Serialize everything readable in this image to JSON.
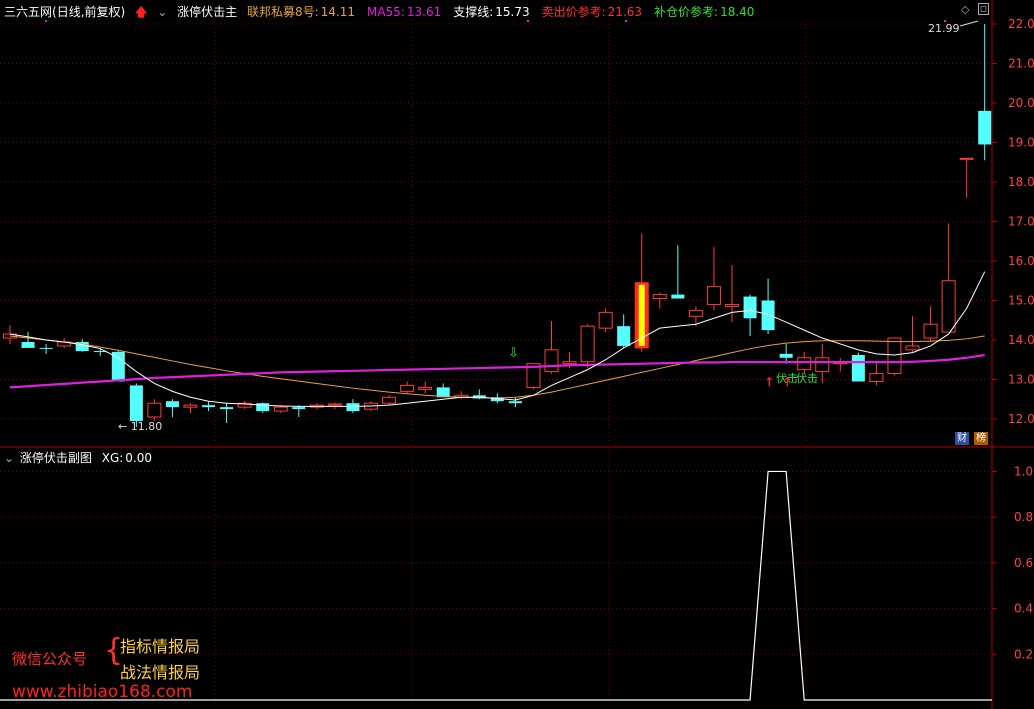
{
  "main_header": {
    "stock_name": "三六五网",
    "mode": "(日线,前复权)",
    "indicator": "涨停伏击主",
    "items": [
      {
        "label": "联邦私募8号:",
        "value": "14.11",
        "color": "#e8a33a"
      },
      {
        "label": "MA55:",
        "value": "13.61",
        "color": "#e020e0"
      },
      {
        "label": "支撑线:",
        "value": "15.73",
        "color": "#ffffff"
      },
      {
        "label": "卖出价参考:",
        "value": "21.63",
        "color": "#ff3030"
      },
      {
        "label": "补仓价参考:",
        "value": "18.40",
        "color": "#30e030"
      }
    ]
  },
  "sub_header": {
    "indicator": "涨停伏击副图",
    "label": "XG:",
    "value": "0.00"
  },
  "axis_main": {
    "ticks": [
      "22.00",
      "21.00",
      "20.00",
      "19.00",
      "18.00",
      "17.00",
      "16.00",
      "15.00",
      "14.00",
      "13.00",
      "12.00"
    ]
  },
  "axis_sub": {
    "ticks": [
      "1.00",
      "0.80",
      "0.60",
      "0.40",
      "0.20"
    ]
  },
  "annotations": {
    "high_label": "21.99",
    "low_label": "← 11.80",
    "signal_1": "伏击",
    "signal_2": "伏击",
    "signal_arrow": "⇩"
  },
  "corner_tags": {
    "tag1": "财",
    "tag2": "榜"
  },
  "watermark": {
    "line1": "微信公众号",
    "line2a": "指标情报局",
    "line2b": "战法情报局",
    "url": "www.zhibiao168.com"
  },
  "colors": {
    "up": "#ff3c3c",
    "down": "#54ffff",
    "ma_orange": "#e8a33a",
    "ma_magenta": "#e020e0",
    "support": "#ffffff",
    "grid": "#7a0000",
    "signal": "#ffff00"
  },
  "chart_data": {
    "type": "candlestick",
    "candles": [
      [
        14.05,
        14.38,
        13.9,
        14.15
      ],
      [
        13.95,
        14.2,
        13.85,
        13.8
      ],
      [
        13.8,
        13.9,
        13.65,
        13.78
      ],
      [
        13.85,
        14.05,
        13.8,
        13.95
      ],
      [
        13.95,
        14.02,
        13.7,
        13.72
      ],
      [
        13.72,
        13.78,
        13.6,
        13.7
      ],
      [
        13.7,
        13.72,
        12.95,
        12.95
      ],
      [
        12.85,
        12.9,
        11.8,
        11.95
      ],
      [
        12.05,
        12.5,
        11.95,
        12.4
      ],
      [
        12.45,
        12.5,
        12.05,
        12.3
      ],
      [
        12.3,
        12.4,
        12.15,
        12.35
      ],
      [
        12.35,
        12.45,
        12.2,
        12.3
      ],
      [
        12.3,
        12.4,
        11.9,
        12.25
      ],
      [
        12.3,
        12.45,
        12.25,
        12.4
      ],
      [
        12.4,
        12.42,
        12.15,
        12.2
      ],
      [
        12.2,
        12.35,
        12.15,
        12.3
      ],
      [
        12.3,
        12.35,
        12.05,
        12.25
      ],
      [
        12.3,
        12.4,
        12.25,
        12.35
      ],
      [
        12.35,
        12.42,
        12.25,
        12.38
      ],
      [
        12.4,
        12.5,
        12.15,
        12.2
      ],
      [
        12.25,
        12.45,
        12.2,
        12.4
      ],
      [
        12.4,
        12.6,
        12.35,
        12.55
      ],
      [
        12.7,
        12.95,
        12.65,
        12.85
      ],
      [
        12.75,
        12.95,
        12.65,
        12.8
      ],
      [
        12.8,
        12.9,
        12.55,
        12.55
      ],
      [
        12.55,
        12.7,
        12.5,
        12.6
      ],
      [
        12.6,
        12.75,
        12.5,
        12.52
      ],
      [
        12.55,
        12.65,
        12.4,
        12.45
      ],
      [
        12.45,
        12.55,
        12.3,
        12.4
      ],
      [
        12.8,
        13.4,
        12.75,
        13.4
      ],
      [
        13.2,
        14.48,
        13.15,
        13.75
      ],
      [
        13.4,
        13.7,
        13.3,
        13.45
      ],
      [
        13.45,
        14.4,
        13.3,
        14.35
      ],
      [
        14.3,
        14.8,
        14.2,
        14.7
      ],
      [
        14.35,
        14.65,
        13.8,
        13.85
      ],
      [
        13.8,
        16.7,
        13.7,
        15.45
      ],
      [
        15.05,
        15.2,
        14.8,
        15.15
      ],
      [
        15.15,
        16.4,
        15.05,
        15.05
      ],
      [
        14.6,
        14.85,
        14.35,
        14.75
      ],
      [
        14.9,
        16.35,
        14.75,
        15.35
      ],
      [
        14.85,
        15.9,
        14.45,
        14.9
      ],
      [
        15.1,
        15.15,
        14.1,
        14.55
      ],
      [
        15.0,
        15.55,
        14.15,
        14.25
      ],
      [
        13.65,
        13.9,
        13.4,
        13.55
      ],
      [
        13.25,
        13.7,
        13.15,
        13.55
      ],
      [
        13.2,
        13.9,
        12.9,
        13.55
      ],
      [
        13.4,
        13.55,
        13.2,
        13.45
      ],
      [
        13.62,
        13.68,
        12.95,
        12.95
      ],
      [
        12.95,
        13.45,
        12.85,
        13.15
      ],
      [
        13.15,
        14.05,
        13.1,
        14.05
      ],
      [
        13.75,
        14.6,
        13.7,
        13.85
      ],
      [
        14.05,
        14.85,
        13.95,
        14.4
      ],
      [
        14.2,
        16.95,
        14.2,
        15.5
      ],
      [
        18.6,
        18.6,
        17.6,
        18.6
      ],
      [
        19.8,
        22.0,
        18.55,
        18.95
      ]
    ],
    "ma_orange": [
      14.1,
      14.05,
      14.0,
      13.95,
      13.9,
      13.82,
      13.74,
      13.65,
      13.56,
      13.47,
      13.38,
      13.3,
      13.22,
      13.15,
      13.08,
      13.02,
      12.96,
      12.9,
      12.84,
      12.78,
      12.73,
      12.68,
      12.64,
      12.6,
      12.57,
      12.55,
      12.54,
      12.53,
      12.55,
      12.6,
      12.68,
      12.78,
      12.88,
      12.98,
      13.08,
      13.18,
      13.28,
      13.38,
      13.48,
      13.58,
      13.68,
      13.78,
      13.86,
      13.92,
      13.96,
      13.98,
      13.98,
      13.98,
      13.97,
      13.96,
      13.96,
      13.97,
      13.99,
      14.03,
      14.1
    ],
    "ma_magenta": [
      12.8,
      12.83,
      12.86,
      12.89,
      12.92,
      12.95,
      12.98,
      13.01,
      13.04,
      13.06,
      13.08,
      13.1,
      13.12,
      13.14,
      13.16,
      13.18,
      13.19,
      13.2,
      13.21,
      13.22,
      13.23,
      13.24,
      13.25,
      13.26,
      13.27,
      13.28,
      13.29,
      13.3,
      13.31,
      13.32,
      13.34,
      13.36,
      13.37,
      13.38,
      13.39,
      13.4,
      13.41,
      13.42,
      13.43,
      13.43,
      13.44,
      13.44,
      13.44,
      13.44,
      13.44,
      13.44,
      13.44,
      13.44,
      13.44,
      13.44,
      13.45,
      13.47,
      13.5,
      13.55,
      13.62
    ],
    "support": [
      14.15,
      14.08,
      14.0,
      13.95,
      13.88,
      13.78,
      13.55,
      13.2,
      12.9,
      12.7,
      12.55,
      12.45,
      12.4,
      12.38,
      12.35,
      12.33,
      12.32,
      12.32,
      12.32,
      12.32,
      12.33,
      12.35,
      12.4,
      12.45,
      12.5,
      12.55,
      12.55,
      12.52,
      12.48,
      12.6,
      12.85,
      13.05,
      13.25,
      13.5,
      13.8,
      14.05,
      14.3,
      14.35,
      14.4,
      14.55,
      14.7,
      14.75,
      14.65,
      14.45,
      14.25,
      14.05,
      13.9,
      13.75,
      13.65,
      13.62,
      13.68,
      13.85,
      14.15,
      14.8,
      15.73
    ],
    "xg": [
      0,
      0,
      0,
      0,
      0,
      0,
      0,
      0,
      0,
      0,
      0,
      0,
      0,
      0,
      0,
      0,
      0,
      0,
      0,
      0,
      0,
      0,
      0,
      0,
      0,
      0,
      0,
      0,
      0,
      0,
      0,
      0,
      0,
      0,
      0,
      0,
      0,
      0,
      0,
      0,
      0,
      0,
      1,
      1,
      0,
      0,
      0,
      0,
      0,
      0,
      0,
      0,
      0,
      0,
      0
    ],
    "main_ylim": [
      11.6,
      22.4
    ],
    "sub_ylim": [
      0,
      1.05
    ]
  }
}
